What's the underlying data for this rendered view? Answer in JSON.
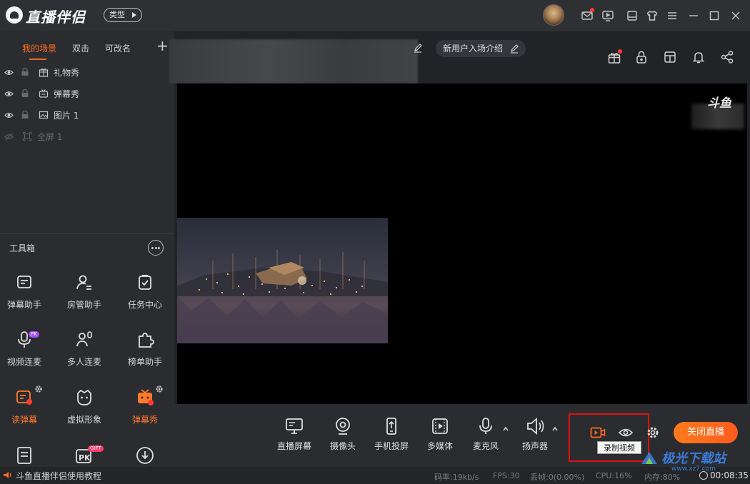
{
  "app": {
    "title": "直播伴侣",
    "type_button": "类型"
  },
  "scene_tabs": [
    "我的场景",
    "双击",
    "可改名"
  ],
  "add_scene": "+",
  "layers": [
    {
      "label": "礼物秀",
      "visible": true,
      "icon": "gift-box-icon"
    },
    {
      "label": "弹幕秀",
      "visible": true,
      "icon": "tv-icon"
    },
    {
      "label": "图片 1",
      "visible": true,
      "icon": "image-icon"
    },
    {
      "label": "全屏 1",
      "visible": false,
      "icon": "fullscreen-icon"
    }
  ],
  "toolbox": {
    "title": "工具箱",
    "tools": [
      {
        "label": "弹幕助手",
        "icon": "message-card-icon"
      },
      {
        "label": "房管助手",
        "icon": "user-manage-icon"
      },
      {
        "label": "任务中心",
        "icon": "clipboard-check-icon"
      },
      {
        "label": "视频连麦",
        "icon": "video-mic-icon",
        "badge": "PK"
      },
      {
        "label": "多人连麦",
        "icon": "multi-mic-icon"
      },
      {
        "label": "榜单助手",
        "icon": "puzzle-icon"
      },
      {
        "label": "读弹幕",
        "icon": "read-danmu-icon",
        "active": true
      },
      {
        "label": "虚拟形象",
        "icon": "avatar-face-icon"
      },
      {
        "label": "弹幕秀",
        "icon": "tv-danmu-icon",
        "active": true
      },
      {
        "label": "",
        "icon": "word-icon"
      },
      {
        "label": "",
        "icon": "pk-gift-icon",
        "badge": "GIFT"
      },
      {
        "label": "",
        "icon": "download-icon"
      }
    ]
  },
  "scene_chip": "新用户入场介绍",
  "watermark": "斗鱼",
  "controls": [
    {
      "label": "直播屏幕",
      "icon": "screen-icon"
    },
    {
      "label": "摄像头",
      "icon": "camera-icon"
    },
    {
      "label": "手机投屏",
      "icon": "phone-cast-icon"
    },
    {
      "label": "多媒体",
      "icon": "media-icon"
    },
    {
      "label": "麦克风",
      "icon": "microphone-icon"
    },
    {
      "label": "扬声器",
      "icon": "speaker-icon"
    }
  ],
  "tooltip": "录制视频",
  "close_live": "关闭直播",
  "status": {
    "tutorial": "斗鱼直播伴侣使用教程",
    "bitrate": "码率:19kb/s",
    "fps": "FPS:30",
    "dropped": "丢帧:0(0.00%)",
    "cpu": "CPU:16%",
    "memory": "内存:80%",
    "timer": "00:08:35"
  },
  "site_watermark": {
    "name": "极光下载站",
    "url": "www.xz7.com"
  },
  "colors": {
    "accent": "#ff6a1f",
    "highlight_box": "#e01010",
    "background": "#2b2c30"
  }
}
